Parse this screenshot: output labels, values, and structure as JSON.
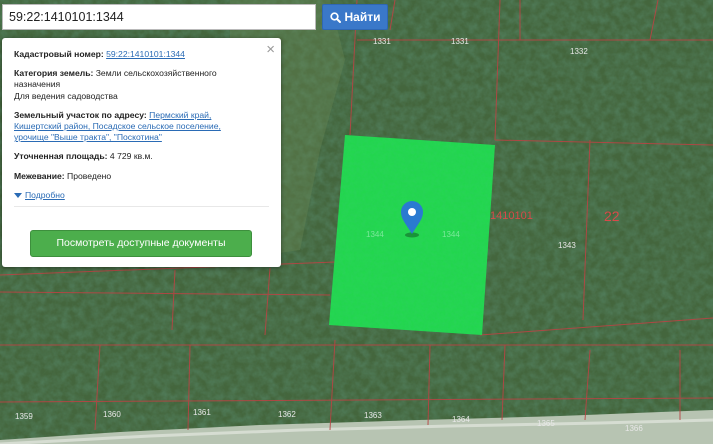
{
  "search": {
    "value": "59:22:1410101:1344",
    "button_label": "Найти"
  },
  "panel": {
    "cadastral_label": "Кадастровый номер:",
    "cadastral_value": "59:22:1410101:1344",
    "category_label": "Категория земель:",
    "category_value_1": "Земли сельскохозяйственного",
    "category_value_2": "назначения",
    "category_value_3": "Для ведения садоводства",
    "address_label": "Земельный участок по адресу:",
    "address_1": "Пермский край,",
    "address_2": "Кишертский район, Посадское сельское поселение,",
    "address_3": "урочище \"Выше тракта\", \"Поскотина\"",
    "area_label": "Уточненная площадь:",
    "area_value": "4 729 кв.м.",
    "survey_label": "Межевание:",
    "survey_value": "Проведено",
    "more_label": "Подробно",
    "docs_button": "Посмотреть доступные документы",
    "close_glyph": "×"
  },
  "map": {
    "parcel_labels": [
      "1331",
      "1331",
      "1332",
      "1343",
      "1359",
      "1360",
      "1361",
      "1362",
      "1363",
      "1364",
      "1365",
      "1366",
      "1344",
      "1344"
    ],
    "quarter_label": "1410101",
    "zone_label": "22",
    "colors": {
      "parcel_fill": "#1fe04f",
      "boundary": "#b84444",
      "marker": "#2a7ad1",
      "label": "#e8e8e8",
      "quarter_label": "#d84a4a"
    }
  },
  "icons": {
    "search": "search-icon",
    "close": "close-icon",
    "marker": "map-marker-icon",
    "expand": "caret-down-icon"
  }
}
